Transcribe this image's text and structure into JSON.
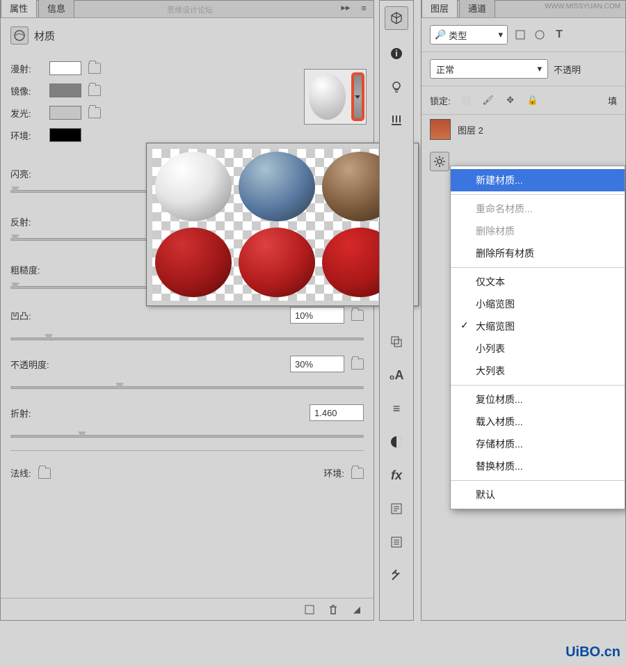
{
  "prop_panel": {
    "tabs": [
      "属性",
      "信息"
    ],
    "title": "材质",
    "rows": {
      "diffuse": "漫射:",
      "mirror": "镜像:",
      "glow": "发光:",
      "env": "环境:"
    },
    "sliders": {
      "shiny": "闪亮:",
      "reflect": "反射:",
      "rough": "粗糙度:",
      "bump": "凹凸:",
      "opacity": "不透明度:",
      "refract": "折射:",
      "normal": "法线:",
      "env2": "环境:"
    },
    "values": {
      "bump": "10%",
      "opacity": "30%",
      "refract": "1.460"
    }
  },
  "layers_panel": {
    "tabs": [
      "图层",
      "通道"
    ],
    "type_label": "类型",
    "mode": "正常",
    "opacity_label": "不透明",
    "lock_label": "锁定:",
    "fill_label": "填",
    "layer_name": "图层 2"
  },
  "ctx_menu": {
    "new": "新建材质...",
    "rename": "重命名材质...",
    "delete": "删除材质",
    "delete_all": "删除所有材质",
    "text_only": "仅文本",
    "small_thumb": "小缩览图",
    "large_thumb": "大缩览图",
    "small_list": "小列表",
    "large_list": "大列表",
    "reset": "复位材质...",
    "load": "载入材质...",
    "save": "存储材质...",
    "replace": "替换材质...",
    "default": "默认"
  },
  "watermarks": {
    "top": "WWW.MISSYUAN.COM",
    "center": "思缘设计论坛",
    "bottom": "UiBO.cn"
  },
  "colors": {
    "diffuse": "#ffffff",
    "mirror": "#808080",
    "glow": "#c5c5c5",
    "env": "#000000"
  }
}
